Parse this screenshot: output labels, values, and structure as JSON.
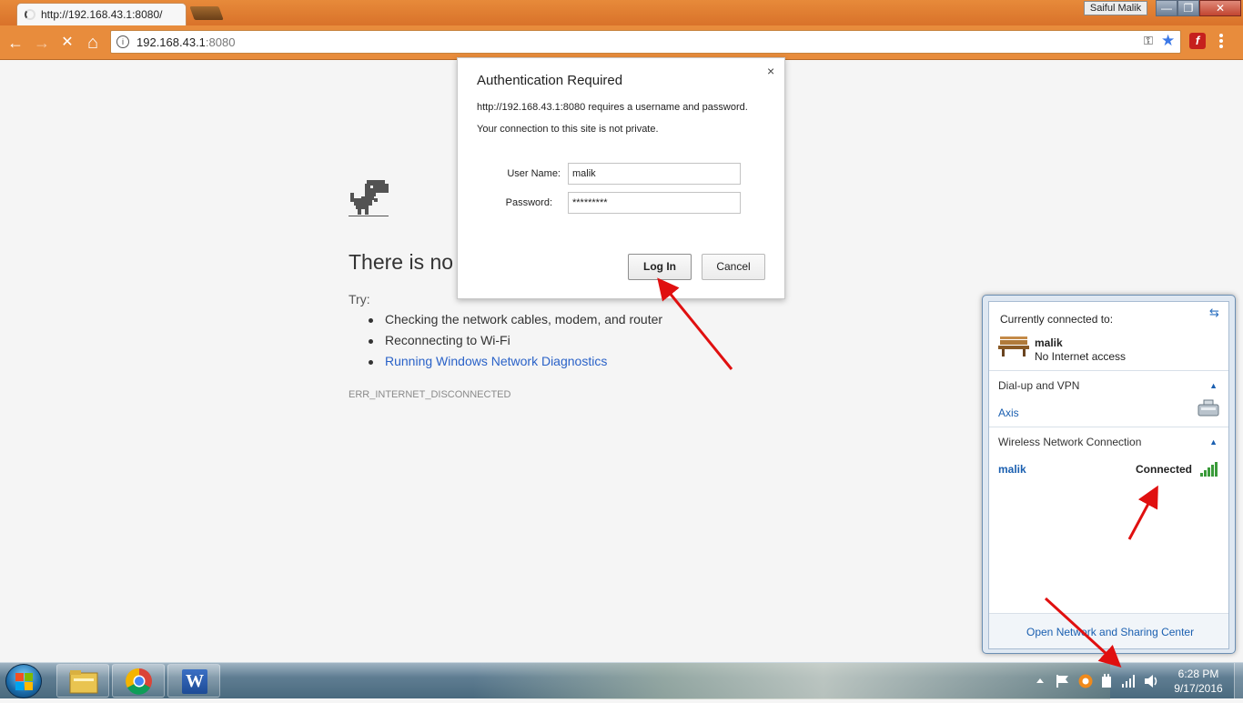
{
  "browser": {
    "tab_title": "http://192.168.43.1:8080/",
    "profile_name": "Saiful Malik",
    "window_buttons": {
      "minimize": "—",
      "maximize": "❐",
      "close": "✕"
    },
    "nav": {
      "back": "←",
      "forward": "→",
      "stop": "✕",
      "home": "⌂"
    },
    "address_host": "192.168.43.1",
    "address_port": ":8080",
    "info_icon": "i",
    "key_icon": "⚿",
    "star_icon": "★",
    "flash_label": "f"
  },
  "page": {
    "heading": "There is no",
    "try_label": "Try:",
    "tips": [
      "Checking the network cables, modem, and router",
      "Reconnecting to Wi-Fi",
      "Running Windows Network Diagnostics"
    ],
    "error_code": "ERR_INTERNET_DISCONNECTED"
  },
  "auth_dialog": {
    "title": "Authentication Required",
    "close": "×",
    "message": "http://192.168.43.1:8080 requires a username and password.",
    "privacy_note": "Your connection to this site is not private.",
    "username_label": "User Name:",
    "username_value": "malik",
    "password_label": "Password:",
    "password_value": "*********",
    "login_button": "Log In",
    "cancel_button": "Cancel"
  },
  "network_flyout": {
    "header": "Currently connected to:",
    "network_name": "malik",
    "network_status": "No Internet access",
    "dialup_section": "Dial-up and VPN",
    "dialup_item": "Axis",
    "wireless_section": "Wireless Network Connection",
    "wireless_item": "malik",
    "wireless_status": "Connected",
    "footer_link": "Open Network and Sharing Center",
    "collapse_icon": "▲",
    "refresh_icon": "⇆"
  },
  "taskbar": {
    "time": "6:28 PM",
    "date": "9/17/2016",
    "word_label": "W",
    "tray_icons": [
      "up-arrow",
      "action-center-flag",
      "avast-icon",
      "power-icon",
      "network-signal-icon",
      "volume-icon"
    ]
  },
  "colors": {
    "accent_orange": "#e88c3c",
    "link_blue": "#2a62c8",
    "annotation_red": "#e01010"
  }
}
